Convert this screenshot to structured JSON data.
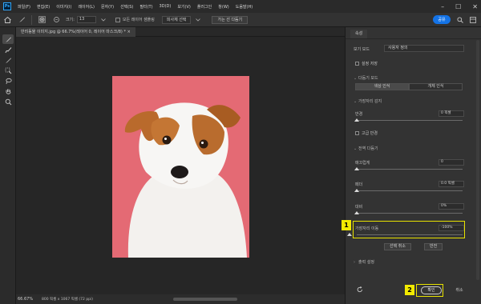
{
  "app": {
    "logo": "Ps"
  },
  "menu": {
    "items": [
      "파일(F)",
      "편집(E)",
      "이미지(I)",
      "레이어(L)",
      "문자(Y)",
      "선택(S)",
      "필터(T)",
      "3D(D)",
      "보기(V)",
      "플러그인",
      "창(W)",
      "도움말(H)"
    ]
  },
  "window_controls": {
    "minimize": "–",
    "maximize": "☐",
    "close": "✕"
  },
  "options": {
    "size_label": "크기:",
    "size_value": "13",
    "sample_all_layers": "모든 레이어 샘플링",
    "select_subject": "피사체 선택",
    "refine_hair": "가는 선 다듬기",
    "share": "공유"
  },
  "document": {
    "tab_title": "반려동물 이미지.jpg @ 66.7%(레이어 0, 레이어 마스크/8) * ×",
    "zoom": "66.67%",
    "info": "800 픽셀 x 1067 픽셀 (72 ppi)"
  },
  "tools": [
    "brush",
    "brush",
    "brush",
    "brush",
    "lasso",
    "hand",
    "zoom"
  ],
  "panel": {
    "tab": "속성",
    "view_mode_label": "보기 모드",
    "view_mode": "사용자 정의",
    "auto_save": "설정 저장",
    "refine_mode_section": "다듬기 모드",
    "refine_mode_options": [
      "색상 인식",
      "개체 인식"
    ],
    "edge_detection_section": "가장자리 감지",
    "radius_label": "반경",
    "radius_value": "0 픽셀",
    "smart_radius": "고급 반경",
    "global_refine_section": "전역 다듬기",
    "smooth_label": "매끄럽게",
    "smooth_value": "0",
    "feather_label": "페더",
    "feather_value": "0.0 픽셀",
    "contrast_label": "대비",
    "contrast_value": "0%",
    "shift_edge_label": "가장자리 이동",
    "shift_edge_value": "-100%",
    "clear_selection": "선택 취소",
    "invert": "반전",
    "output_section": "출력 설정",
    "ok": "확인",
    "cancel": "취소"
  },
  "annotations": {
    "badge1": "1",
    "badge2": "2",
    "color": "#f2ea00"
  }
}
